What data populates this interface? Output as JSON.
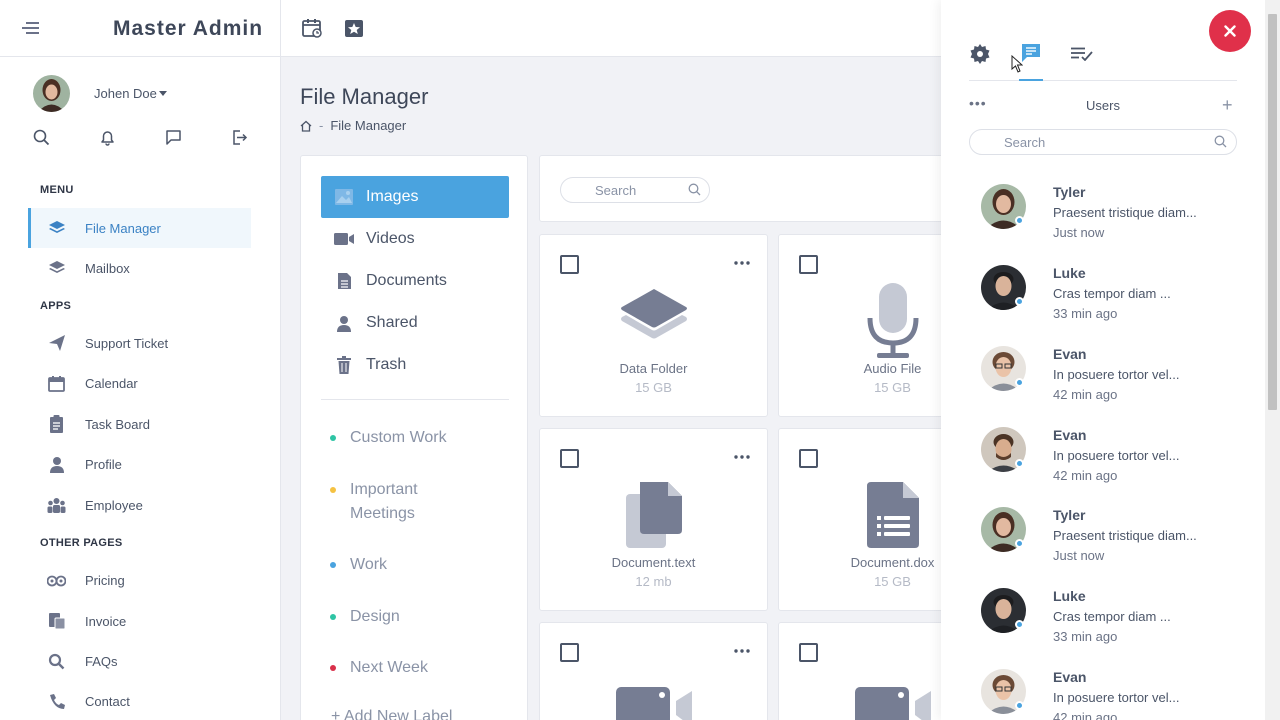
{
  "brand": {
    "title": "Master Admin"
  },
  "user": {
    "name": "Johen Doe"
  },
  "sidebar": {
    "sections": [
      "MENU",
      "APPS",
      "OTHER PAGES"
    ],
    "menu": [
      {
        "label": "File Manager",
        "icon": "layers-icon",
        "active": true
      },
      {
        "label": "Mailbox",
        "icon": "layers-icon"
      }
    ],
    "apps": [
      {
        "label": "Support Ticket",
        "icon": "send-icon"
      },
      {
        "label": "Calendar",
        "icon": "calendar-icon"
      },
      {
        "label": "Task Board",
        "icon": "clipboard-icon"
      },
      {
        "label": "Profile",
        "icon": "user-icon"
      },
      {
        "label": "Employee",
        "icon": "users-icon"
      }
    ],
    "other": [
      {
        "label": "Pricing",
        "icon": "coins-icon"
      },
      {
        "label": "Invoice",
        "icon": "money-icon"
      },
      {
        "label": "FAQs",
        "icon": "search-icon"
      },
      {
        "label": "Contact",
        "icon": "phone-icon"
      }
    ]
  },
  "page": {
    "title": "File Manager",
    "breadcrumb": "File Manager"
  },
  "file_nav": [
    {
      "label": "Images",
      "icon": "image-icon",
      "active": true
    },
    {
      "label": "Videos",
      "icon": "video-icon"
    },
    {
      "label": "Documents",
      "icon": "document-icon"
    },
    {
      "label": "Shared",
      "icon": "user-icon"
    },
    {
      "label": "Trash",
      "icon": "trash-icon"
    }
  ],
  "labels": [
    {
      "label": "Custom Work",
      "color": "#2ec4a4"
    },
    {
      "label": "Important Meetings",
      "color": "#f5c242"
    },
    {
      "label": "Work",
      "color": "#4aa3df"
    },
    {
      "label": "Design",
      "color": "#2ec4a4"
    },
    {
      "label": "Next Week",
      "color": "#d9304a"
    }
  ],
  "add_label": "+ Add New Label",
  "file_search": {
    "placeholder": "Search"
  },
  "files": [
    {
      "name": "Data Folder",
      "size": "15 GB",
      "icon": "layers-icon"
    },
    {
      "name": "Audio File",
      "size": "15 GB",
      "icon": "microphone-icon"
    },
    {
      "name": "Document.text",
      "size": "12 mb",
      "icon": "files-icon"
    },
    {
      "name": "Document.dox",
      "size": "15 GB",
      "icon": "document-list-icon"
    },
    {
      "name": "",
      "size": "",
      "icon": "video-icon"
    },
    {
      "name": "",
      "size": "",
      "icon": "video-icon"
    }
  ],
  "panel": {
    "tabs": [
      "settings-icon",
      "chat-icon",
      "task-list-icon"
    ],
    "active_tab": "chat-icon",
    "users_title": "Users",
    "more": "•••",
    "add": "+",
    "search_placeholder": "Search"
  },
  "users": [
    {
      "name": "Tyler",
      "message": "Praesent tristique diam...",
      "time": "Just now"
    },
    {
      "name": "Luke",
      "message": "Cras tempor diam ...",
      "time": "33 min ago"
    },
    {
      "name": "Evan",
      "message": "In posuere tortor vel...",
      "time": "42 min ago"
    },
    {
      "name": "Evan",
      "message": "In posuere tortor vel...",
      "time": "42 min ago"
    },
    {
      "name": "Tyler",
      "message": "Praesent tristique diam...",
      "time": "Just now"
    },
    {
      "name": "Luke",
      "message": "Cras tempor diam ...",
      "time": "33 min ago"
    },
    {
      "name": "Evan",
      "message": "In posuere tortor vel...",
      "time": "42 min ago"
    }
  ],
  "colors": {
    "accent": "#4aa3df",
    "close": "#e0304a",
    "icon": "#6b7289",
    "text": "#4b5568"
  }
}
